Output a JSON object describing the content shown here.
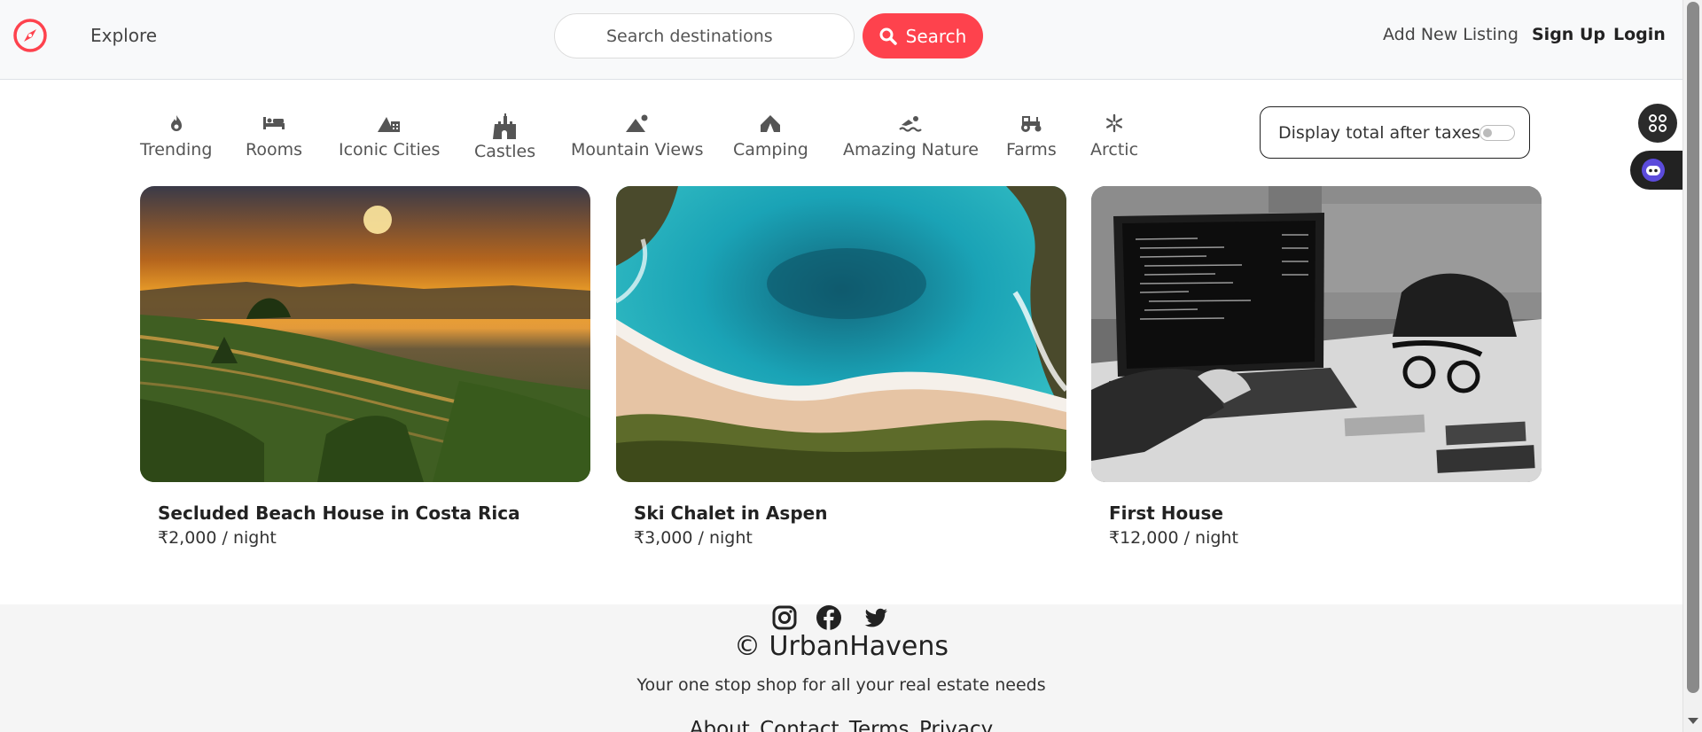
{
  "navbar": {
    "logo_icon": "compass-icon",
    "explore": "Explore",
    "search_placeholder": "Search destinations",
    "search_label": "Search",
    "add_listing": "Add New Listing",
    "signup": "Sign Up",
    "login": "Login",
    "brand_color": "#fe424d"
  },
  "filters": [
    {
      "label": "Trending",
      "icon": "fire-icon"
    },
    {
      "label": "Rooms",
      "icon": "bed-icon"
    },
    {
      "label": "Iconic Cities",
      "icon": "mountain-city-icon"
    },
    {
      "label": "Castles",
      "icon": "castle-icon"
    },
    {
      "label": "Mountain Views",
      "icon": "mountain-sun-icon"
    },
    {
      "label": "Camping",
      "icon": "campground-icon"
    },
    {
      "label": "Amazing Nature",
      "icon": "person-swimming-icon"
    },
    {
      "label": "Farms",
      "icon": "tractor-icon"
    },
    {
      "label": "Arctic",
      "icon": "snowflake-icon"
    }
  ],
  "tax_toggle": {
    "label": "Display total after taxes",
    "enabled": false
  },
  "listings": [
    {
      "title": "Secluded Beach House in Costa Rica",
      "price": "₹2,000 / night",
      "image": "rice-terraces-sunset"
    },
    {
      "title": "Ski Chalet in Aspen",
      "price": "₹3,000 / night",
      "image": "turquoise-bay-aerial"
    },
    {
      "title": "First House",
      "price": "₹12,000 / night",
      "image": "laptop-desk-bw"
    }
  ],
  "footer": {
    "socials": [
      "instagram-icon",
      "facebook-icon",
      "twitter-icon"
    ],
    "brand": "© UrbanHavens",
    "tagline": "Your one stop shop for all your real estate needs",
    "links": [
      "About",
      "Contact",
      "Terms",
      "Privacy"
    ]
  }
}
